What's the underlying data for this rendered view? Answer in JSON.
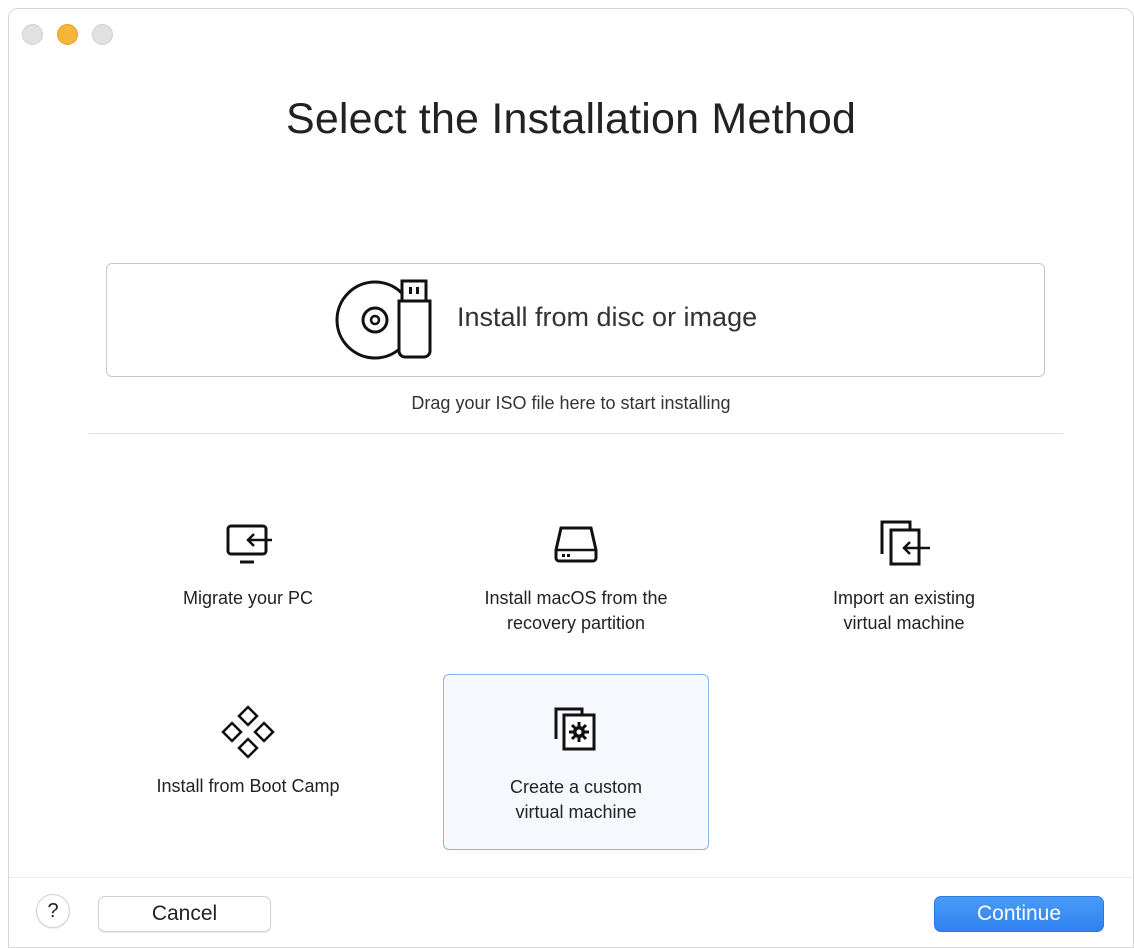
{
  "window": {
    "title": "Select the Installation Method"
  },
  "disc_install": {
    "label": "Install from disc or image",
    "hint": "Drag your ISO file here to start installing",
    "icon": "disc-usb-icon"
  },
  "options": [
    {
      "label": "Migrate your PC",
      "icon": "monitor-arrow-icon",
      "selected": false
    },
    {
      "label": "Install macOS from the\nrecovery partition",
      "icon": "hard-drive-icon",
      "selected": false
    },
    {
      "label": "Import an existing\nvirtual machine",
      "icon": "import-vm-icon",
      "selected": false
    },
    {
      "label": "Install from Boot Camp",
      "icon": "bootcamp-diamonds-icon",
      "selected": false
    },
    {
      "label": "Create a custom\nvirtual machine",
      "icon": "custom-vm-gear-icon",
      "selected": true
    }
  ],
  "footer": {
    "help_label": "?",
    "cancel_label": "Cancel",
    "continue_label": "Continue"
  },
  "colors": {
    "accent": "#2f82f0",
    "selected_bg": "#f5f8fd",
    "selected_border": "#8fb3e6",
    "minimize": "#f5b53b"
  }
}
